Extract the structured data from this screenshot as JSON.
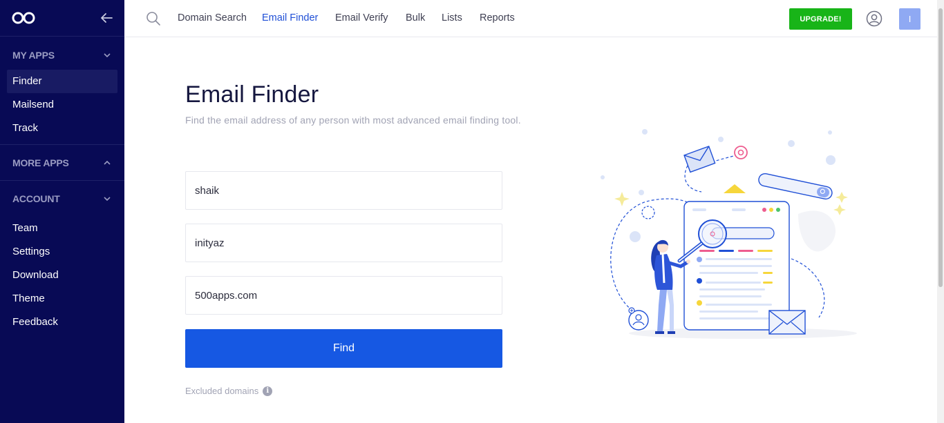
{
  "sidebar": {
    "sections": {
      "my_apps": {
        "label": "MY APPS",
        "items": [
          "Finder",
          "Mailsend",
          "Track"
        ]
      },
      "more_apps": {
        "label": "MORE APPS"
      },
      "account": {
        "label": "ACCOUNT",
        "items": [
          "Team",
          "Settings",
          "Download",
          "Theme",
          "Feedback"
        ]
      }
    },
    "active_item": "Finder"
  },
  "topnav": {
    "links": [
      "Domain Search",
      "Email Finder",
      "Email Verify",
      "Bulk",
      "Lists",
      "Reports"
    ],
    "active_link": "Email Finder",
    "upgrade_label": "UPGRADE!",
    "avatar_initial": "I"
  },
  "main": {
    "title": "Email Finder",
    "subtitle": "Find the email address of any person with most advanced email finding tool.",
    "fields": {
      "first_name": "shaik",
      "last_name": "inityaz",
      "domain": "500apps.com"
    },
    "find_label": "Find",
    "excluded_label": "Excluded domains",
    "info_glyph": "i"
  },
  "colors": {
    "sidebar_bg": "#080a55",
    "accent": "#1658e3",
    "upgrade": "#18b418",
    "avatar": "#8fa9f3"
  },
  "icons": [
    "infinity-logo-icon",
    "arrow-left-icon",
    "chevron-down-icon",
    "chevron-up-icon",
    "search-icon",
    "user-circle-icon",
    "info-icon"
  ]
}
